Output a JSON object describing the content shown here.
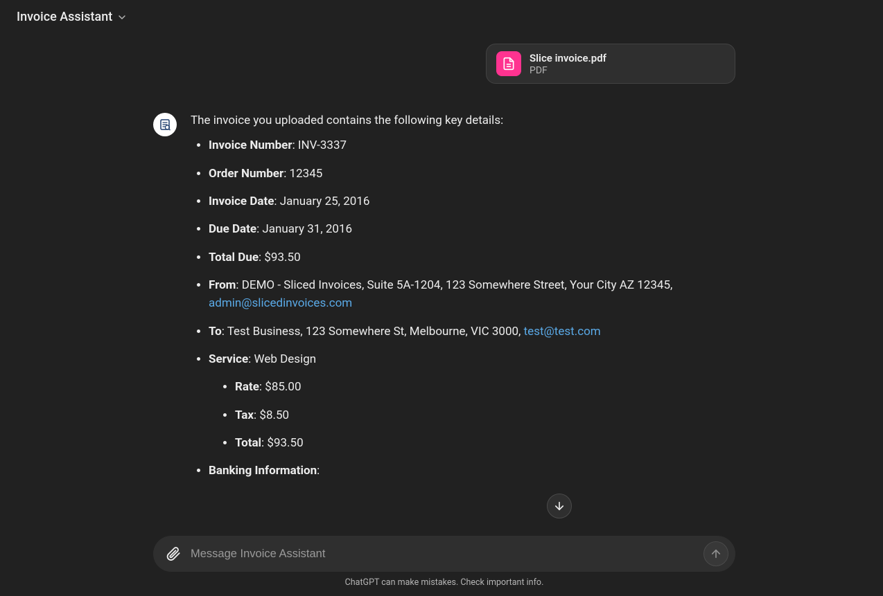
{
  "header": {
    "title": "Invoice Assistant"
  },
  "user_message": {
    "attachment": {
      "name": "Slice invoice.pdf",
      "type": "PDF"
    }
  },
  "assistant_message": {
    "intro": "The invoice you uploaded contains the following key details:",
    "items": {
      "invoice_number": {
        "label": "Invoice Number",
        "value": "INV-3337"
      },
      "order_number": {
        "label": "Order Number",
        "value": "12345"
      },
      "invoice_date": {
        "label": "Invoice Date",
        "value": "January 25, 2016"
      },
      "due_date": {
        "label": "Due Date",
        "value": "January 31, 2016"
      },
      "total_due": {
        "label": "Total Due",
        "value": "$93.50"
      },
      "from": {
        "label": "From",
        "value": "DEMO - Sliced Invoices, Suite 5A-1204, 123 Somewhere Street, Your City AZ 12345, ",
        "link": "admin@slicedinvoices.com"
      },
      "to": {
        "label": "To",
        "value": "Test Business, 123 Somewhere St, Melbourne, VIC 3000, ",
        "link": "test@test.com"
      },
      "service": {
        "label": "Service",
        "value": "Web Design",
        "sub": {
          "rate": {
            "label": "Rate",
            "value": "$85.00"
          },
          "tax": {
            "label": "Tax",
            "value": "$8.50"
          },
          "total": {
            "label": "Total",
            "value": "$93.50"
          }
        }
      },
      "banking": {
        "label": "Banking Information",
        "value": ""
      }
    }
  },
  "composer": {
    "placeholder": "Message Invoice Assistant"
  },
  "footer": {
    "note": "ChatGPT can make mistakes. Check important info."
  }
}
